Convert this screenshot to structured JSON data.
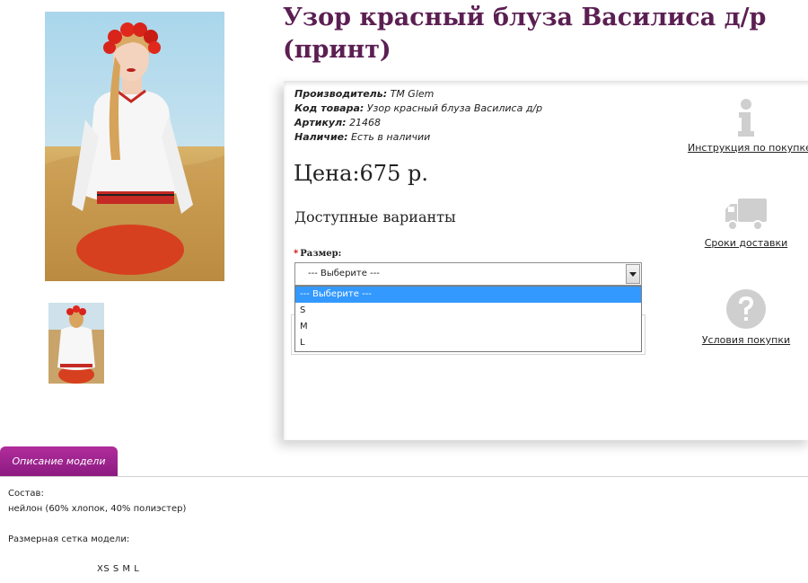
{
  "product": {
    "title": "Узор красный блуза Василиса д/р (принт)",
    "specs": [
      {
        "key": "Производитель:",
        "value": "TM Glem"
      },
      {
        "key": "Код товара:",
        "value": "Узор красный блуза Василиса д/р"
      },
      {
        "key": "Артикул:",
        "value": "21468"
      },
      {
        "key": "Наличие:",
        "value": "Есть в наличии"
      }
    ],
    "price": "Цена:675 р."
  },
  "variants": {
    "title": "Доступные варианты",
    "required_mark": "*",
    "size_label": "Размер:",
    "selected": "--- Выберите ---",
    "options": [
      "--- Выберите ---",
      "S",
      "M",
      "L"
    ]
  },
  "side_links": {
    "instruction": "Инструкция по покупке",
    "delivery": "Сроки доставки",
    "terms": "Условия покупки",
    "icons": [
      "info-icon",
      "truck-icon",
      "question-icon"
    ]
  },
  "tabs": {
    "description": "Описание модели"
  },
  "description": {
    "composition_label": "Состав:",
    "composition_value": "нейлон (60% хлопок, 40% полиэстер)",
    "size_grid_label": "Размерная сетка модели:",
    "size_grid_values": "XS S M L"
  },
  "colors": {
    "title": "#5b1f52",
    "tab": "#9b2190",
    "dropdown_highlight": "#3399ff",
    "required": "#d00000"
  }
}
